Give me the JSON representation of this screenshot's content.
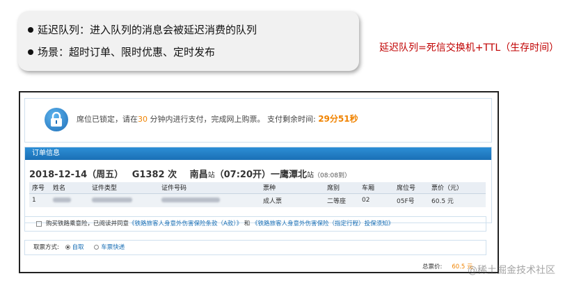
{
  "callout": {
    "line1": "延迟队列：进入队列的消息会被延迟消费的队列",
    "line2": "场景：超时订单、限时优惠、定时发布"
  },
  "side_note": "延迟队列=死信交换机+TTL（生存时间）",
  "lock": {
    "text_a": "席位已锁定，请在",
    "minutes": "30",
    "text_b": "分钟内进行支付，完成网上购票。 支付剩余时间:",
    "remaining": "29分51秒"
  },
  "order": {
    "header": "订单信息",
    "date": "2018-12-14（周五）",
    "train": "G1382 次",
    "from": "南昌",
    "from_suffix": "站",
    "depart": "（07:20开）",
    "to": "一鹰潭北",
    "to_suffix": "站",
    "arrive": "（08:08到）",
    "columns": [
      "序号",
      "姓名",
      "证件类型",
      "证件号码",
      "票种",
      "席别",
      "车厢",
      "席位号",
      "票价（元）"
    ],
    "row": {
      "index": "1",
      "ticket_type": "成人票",
      "seat_class": "二等座",
      "car": "02",
      "seat_no": "05F号",
      "price": "60.5 元"
    }
  },
  "insurance": {
    "text": "购买铁路乘意险，已阅读并同意",
    "link1": "《铁路旅客人身意外伤害保险条款（A款）》",
    "and": "和",
    "link2": "《铁路旅客人身意外伤害保险（指定行程）投保须知》"
  },
  "pickup": {
    "label": "取票方式:",
    "option1": "自取",
    "option2": "车票快递"
  },
  "total": {
    "label": "总票价:",
    "value": "60.5 元"
  },
  "watermark": "@稀土掘金技术社区"
}
